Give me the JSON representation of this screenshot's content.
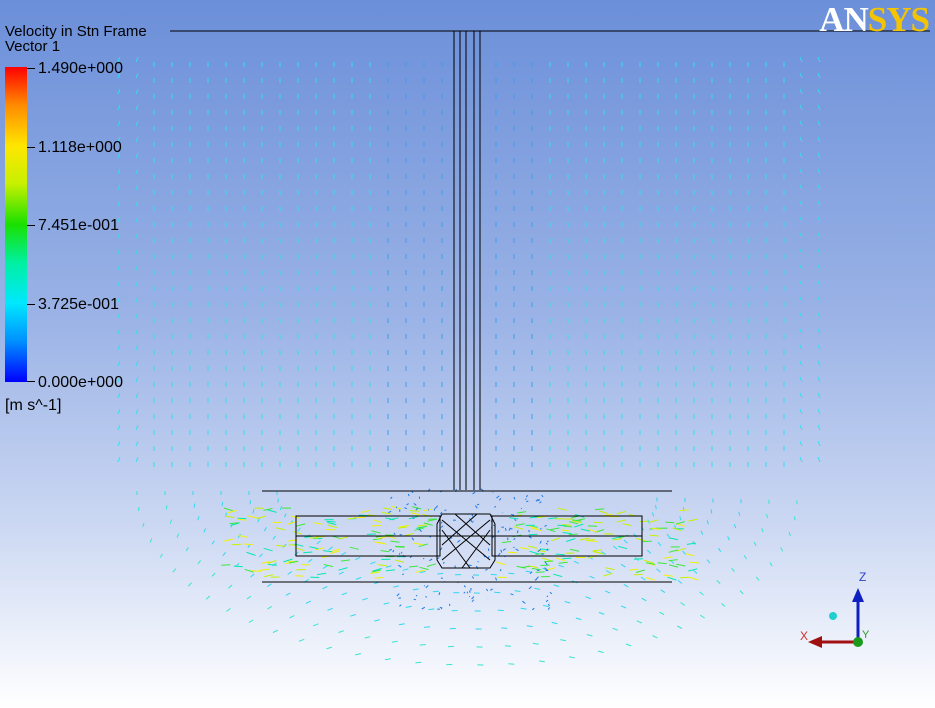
{
  "legend": {
    "title": "Velocity in Stn Frame",
    "subtitle": "Vector 1",
    "ticks": [
      "1.490e+000",
      "1.118e+000",
      "7.451e-001",
      "3.725e-001",
      "0.000e+000"
    ],
    "units": "[m s^-1]",
    "colormap": [
      "#ff0000",
      "#ffe600",
      "#19e000",
      "#00e8ff",
      "#0000ff"
    ]
  },
  "logo": {
    "part1": "AN",
    "part2": "SYS"
  },
  "axis_triad": {
    "z_label": "Z",
    "x_label": "X",
    "y_label": "Y"
  },
  "colors": {
    "background_top": "#6b8fd9",
    "background_bottom": "#ffffff",
    "geometry": "#000000"
  }
}
